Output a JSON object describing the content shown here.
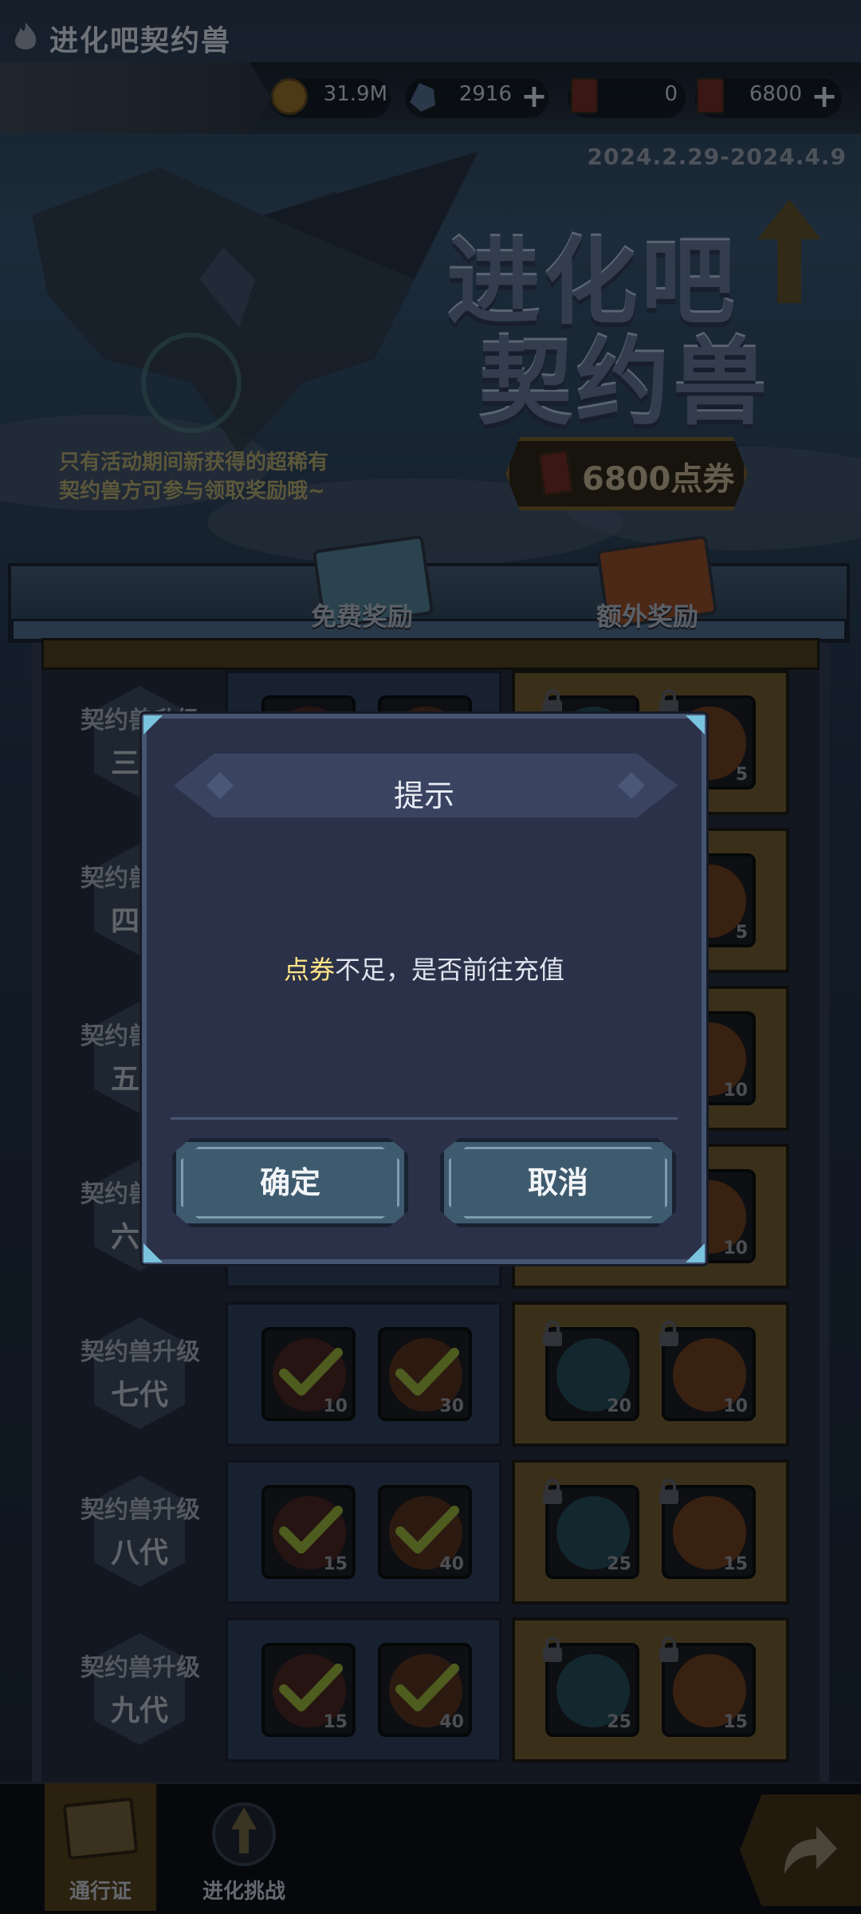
{
  "header": {
    "title": "进化吧契约兽",
    "resources": [
      {
        "icon": "gold-coin-icon",
        "value": "31.9M",
        "has_plus": false
      },
      {
        "icon": "crystal-icon",
        "value": "2916",
        "has_plus": true
      },
      {
        "icon": "ticket-card-icon",
        "value": "0",
        "has_plus": false
      },
      {
        "icon": "point-ticket-icon",
        "value": "6800",
        "has_plus": true
      }
    ]
  },
  "event": {
    "date_range": "2024.2.29-2024.4.9",
    "logo_line1": "进化吧",
    "logo_line2": "契约兽",
    "notice_line1": "只有活动期间新获得的超稀有",
    "notice_line2": "契约兽方可参与领取奖励哦~",
    "price": "6800点券"
  },
  "reward_columns": {
    "free": "免费奖励",
    "extra": "额外奖励"
  },
  "tiers": [
    {
      "line1": "契约兽升级",
      "line2": "三代",
      "free_counts": [
        "",
        ""
      ],
      "extra_counts": [
        "",
        "5"
      ]
    },
    {
      "line1": "契约兽升级",
      "line2": "四代",
      "free_counts": [
        "",
        ""
      ],
      "extra_counts": [
        "",
        "5"
      ]
    },
    {
      "line1": "契约兽升级",
      "line2": "五代",
      "free_counts": [
        "",
        ""
      ],
      "extra_counts": [
        "",
        "10"
      ]
    },
    {
      "line1": "契约兽升级",
      "line2": "六代",
      "free_counts": [
        "",
        ""
      ],
      "extra_counts": [
        "",
        "10"
      ]
    },
    {
      "line1": "契约兽升级",
      "line2": "七代",
      "free_counts": [
        "10",
        "30"
      ],
      "extra_counts": [
        "20",
        "10"
      ]
    },
    {
      "line1": "契约兽升级",
      "line2": "八代",
      "free_counts": [
        "15",
        "40"
      ],
      "extra_counts": [
        "25",
        "15"
      ]
    },
    {
      "line1": "契约兽升级",
      "line2": "九代",
      "free_counts": [
        "15",
        "40"
      ],
      "extra_counts": [
        "25",
        "15"
      ]
    }
  ],
  "bottom_tabs": [
    {
      "label": "通行证",
      "active": true
    },
    {
      "label": "进化挑战",
      "active": false
    }
  ],
  "dialog": {
    "title": "提示",
    "message_highlight": "点券",
    "message_rest": "不足，是否前往充值",
    "confirm_label": "确定",
    "cancel_label": "取消"
  },
  "colors": {
    "highlight": "#ffe58a",
    "dialog_bg": "#2b3148",
    "button_bg": "#3e5a6e"
  }
}
